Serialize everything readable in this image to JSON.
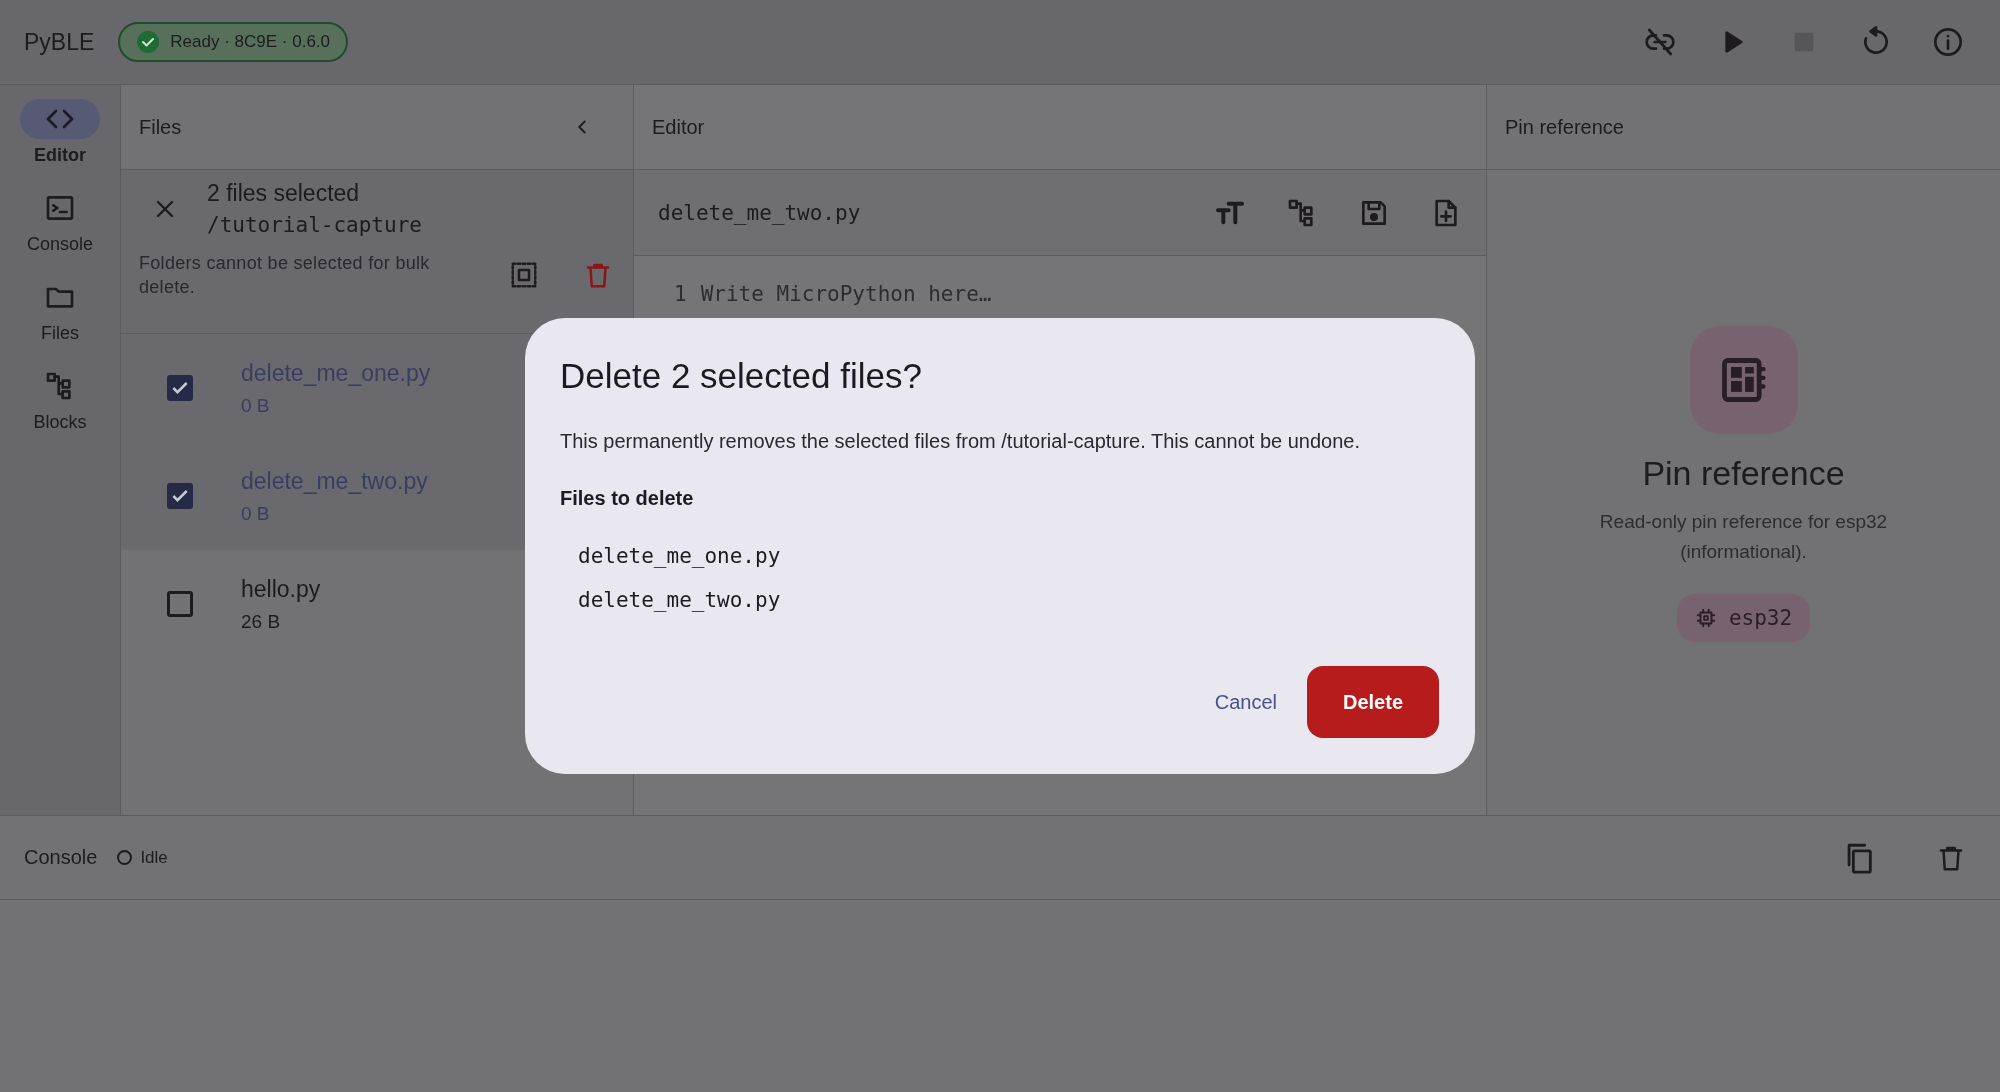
{
  "app_bar": {
    "title": "PyBLE",
    "status": {
      "label": "Ready · 8C9E · 0.6.0",
      "kind": "ok"
    },
    "actions": [
      {
        "kind": "unlink",
        "disabled": false
      },
      {
        "kind": "play",
        "disabled": false
      },
      {
        "kind": "stop",
        "disabled": true
      },
      {
        "kind": "restart",
        "disabled": false
      },
      {
        "kind": "info",
        "disabled": false
      }
    ]
  },
  "nav_rail": {
    "items": [
      {
        "label": "Editor",
        "kind": "code",
        "selected": true
      },
      {
        "label": "Console",
        "kind": "terminal",
        "selected": false
      },
      {
        "label": "Files",
        "kind": "folder",
        "selected": false
      },
      {
        "label": "Blocks",
        "kind": "blocks",
        "selected": false
      }
    ]
  },
  "files_pane": {
    "title": "Files",
    "selection": {
      "title": "2 files selected",
      "path": "/tutorial-capture",
      "note": "Folders cannot be selected for bulk delete."
    },
    "files": [
      {
        "name": "delete_me_one.py",
        "size": "0 B",
        "checked": true
      },
      {
        "name": "delete_me_two.py",
        "size": "0 B",
        "checked": true
      },
      {
        "name": "hello.py",
        "size": "26 B",
        "checked": false
      }
    ]
  },
  "editor": {
    "title": "Editor",
    "filename": "delete_me_two.py",
    "lines": [
      {
        "number": "1",
        "text": "Write MicroPython here…"
      }
    ]
  },
  "pin_pane": {
    "title": "Pin reference",
    "heading": "Pin reference",
    "description": "Read-only pin reference for esp32 (informational).",
    "chip": "esp32"
  },
  "console": {
    "title": "Console",
    "status": "Idle"
  },
  "dialog": {
    "title": "Delete 2 selected files?",
    "message": "This permanently removes the selected files from /tutorial-capture. This cannot be undone.",
    "list_title": "Files to delete",
    "files": [
      "delete_me_one.py",
      "delete_me_two.py"
    ],
    "buttons": [
      {
        "label": "Cancel",
        "kind": "text"
      },
      {
        "label": "Delete",
        "kind": "danger"
      }
    ]
  }
}
